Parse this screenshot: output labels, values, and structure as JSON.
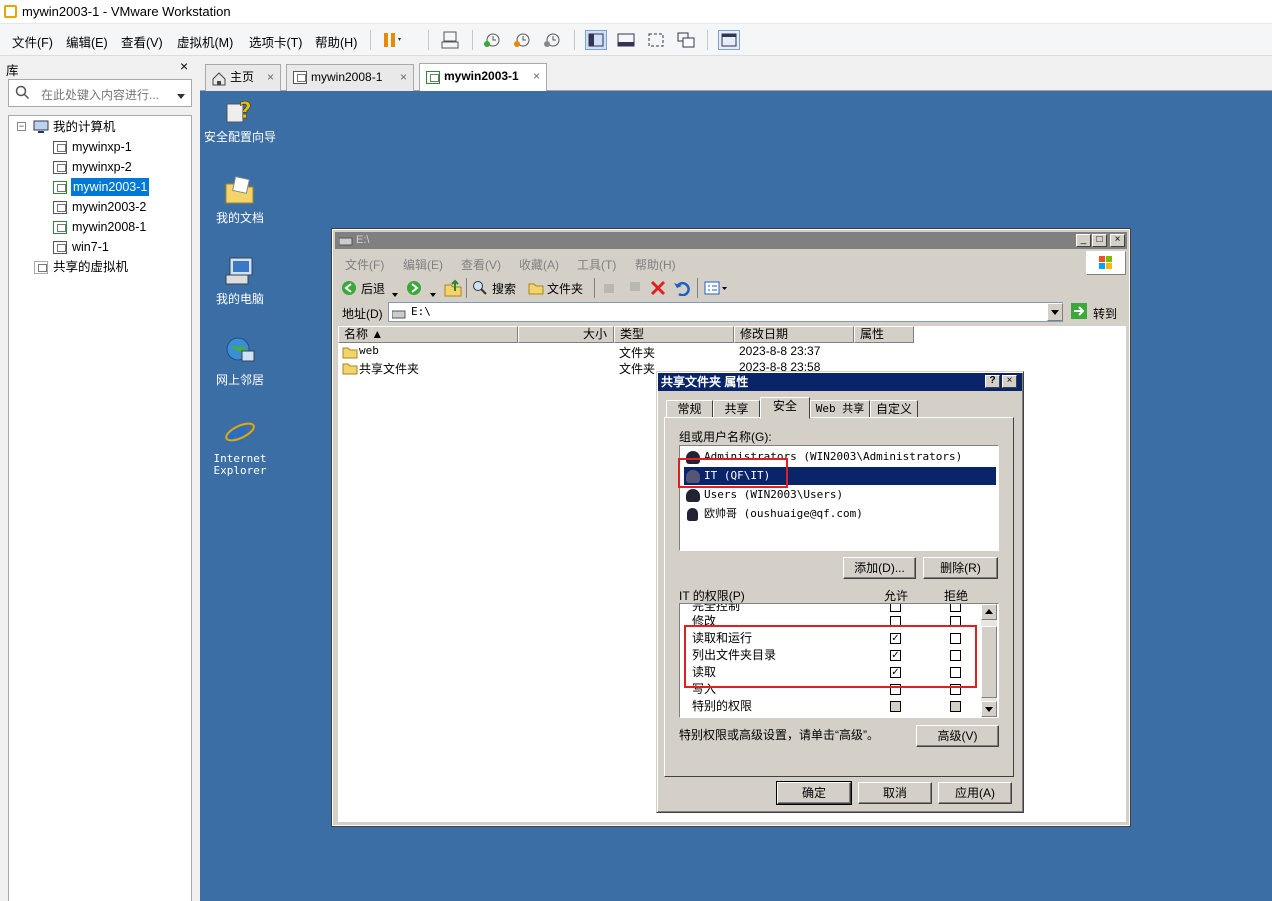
{
  "window": {
    "title": "mywin2003-1 - VMware Workstation"
  },
  "menu": [
    "文件(F)",
    "编辑(E)",
    "查看(V)",
    "虚拟机(M)",
    "选项卡(T)",
    "帮助(H)"
  ],
  "library": {
    "title": "库",
    "close": "×",
    "search_placeholder": "在此处键入内容进行...",
    "root": "我的计算机",
    "vms": [
      "mywinxp-1",
      "mywinxp-2",
      "mywin2003-1",
      "mywin2003-2",
      "mywin2008-1",
      "win7-1"
    ],
    "selected": "mywin2003-1",
    "shared": "共享的虚拟机"
  },
  "tabs": [
    {
      "label": "主页",
      "close": "×"
    },
    {
      "label": "mywin2008-1",
      "close": "×"
    },
    {
      "label": "mywin2003-1",
      "close": "×"
    }
  ],
  "desktop_icons": [
    "安全配置向导",
    "我的文档",
    "我的电脑",
    "网上邻居",
    "Internet Explorer"
  ],
  "explorer": {
    "title": "E:\\",
    "menu": [
      "文件(F)",
      "编辑(E)",
      "查看(V)",
      "收藏(A)",
      "工具(T)",
      "帮助(H)"
    ],
    "back": "后退",
    "search": "搜索",
    "folders": "文件夹",
    "address_label": "地址(D)",
    "address": "E:\\",
    "go": "转到",
    "columns": [
      "名称 ▲",
      "大小",
      "类型",
      "修改日期",
      "属性"
    ],
    "files": [
      {
        "name": "web",
        "type": "文件夹",
        "date": "2023-8-8 23:37"
      },
      {
        "name": "共享文件夹",
        "type": "文件夹",
        "date": "2023-8-8 23:58"
      }
    ]
  },
  "dialog": {
    "title": "共享文件夹 属性",
    "help": "?",
    "close": "×",
    "tabs": [
      "常规",
      "共享",
      "安全",
      "Web 共享",
      "自定义"
    ],
    "active_tab": "安全",
    "users_label": "组或用户名称(G):",
    "users": [
      "Administrators (WIN2003\\Administrators)",
      "IT (QF\\IT)",
      "Users (WIN2003\\Users)",
      "欧帅哥 (oushuaige@qf.com)"
    ],
    "selected_user": "IT (QF\\IT)",
    "add": "添加(D)...",
    "remove": "删除(R)",
    "perm_label": "IT 的权限(P)",
    "allow": "允许",
    "deny": "拒绝",
    "permissions": [
      {
        "name": "完全控制",
        "allow": false,
        "deny": false
      },
      {
        "name": "修改",
        "allow": false,
        "deny": false
      },
      {
        "name": "读取和运行",
        "allow": true,
        "deny": false
      },
      {
        "name": "列出文件夹目录",
        "allow": true,
        "deny": false
      },
      {
        "name": "读取",
        "allow": true,
        "deny": false
      },
      {
        "name": "写入",
        "allow": false,
        "deny": false
      },
      {
        "name": "特别的权限",
        "allow": false,
        "deny": false
      }
    ],
    "advanced_note": "特别权限或高级设置，请单击“高级”。",
    "advanced": "高级(V)",
    "ok": "确定",
    "cancel": "取消",
    "apply": "应用(A)"
  },
  "colors": {
    "desktop": "#3a6ea5",
    "dialog_title": "#0a246a",
    "highlight": "#e02020",
    "selection": "#0a246a"
  }
}
